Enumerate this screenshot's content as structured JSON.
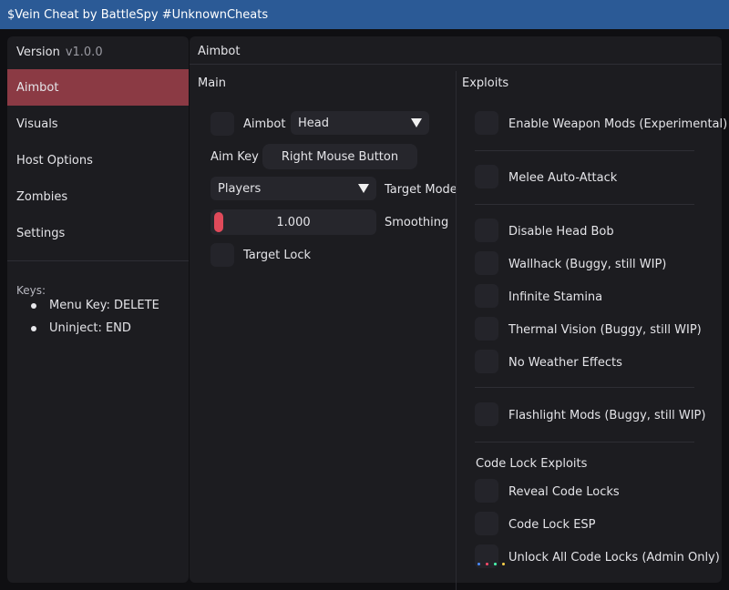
{
  "window": {
    "title": "$Vein Cheat by BattleSpy #UnknownCheats"
  },
  "sidebar": {
    "version_label": "Version",
    "version_value": "v1.0.0",
    "items": [
      {
        "label": "Aimbot",
        "active": true
      },
      {
        "label": "Visuals",
        "active": false
      },
      {
        "label": "Host Options",
        "active": false
      },
      {
        "label": "Zombies",
        "active": false
      },
      {
        "label": "Settings",
        "active": false
      }
    ],
    "keys_title": "Keys:",
    "keys": [
      {
        "label": "Menu Key: DELETE"
      },
      {
        "label": "Uninject: END"
      }
    ]
  },
  "content": {
    "title": "Aimbot",
    "main": {
      "section_label": "Main",
      "aimbot_label": "Aimbot",
      "bone_value": "Head",
      "aim_key_label": "Aim Key",
      "aim_key_value": "Right Mouse Button",
      "target_mode_value": "Players",
      "target_mode_label": "Target Mode",
      "smoothing_value": "1.000",
      "smoothing_label": "Smoothing",
      "target_lock_label": "Target Lock"
    },
    "exploits": {
      "section_label": "Exploits",
      "items": [
        {
          "label": "Enable Weapon Mods (Experimental)"
        },
        {
          "label": "Melee Auto-Attack"
        },
        {
          "label": "Disable Head Bob"
        },
        {
          "label": "Wallhack (Buggy, still WIP)"
        },
        {
          "label": "Infinite Stamina"
        },
        {
          "label": "Thermal Vision (Buggy, still WIP)"
        },
        {
          "label": "No Weather Effects"
        },
        {
          "label": "Flashlight Mods (Buggy, still WIP)"
        }
      ],
      "code_lock_title": "Code Lock Exploits",
      "code_lock_items": [
        {
          "label": "Reveal Code Locks"
        },
        {
          "label": "Code Lock ESP"
        },
        {
          "label": "Unlock All Code Locks (Admin Only)"
        }
      ]
    }
  },
  "colors": {
    "titlebar": "#2b5a96",
    "active_tab": "#8b3a44",
    "slider_grab": "#e04a5a"
  }
}
